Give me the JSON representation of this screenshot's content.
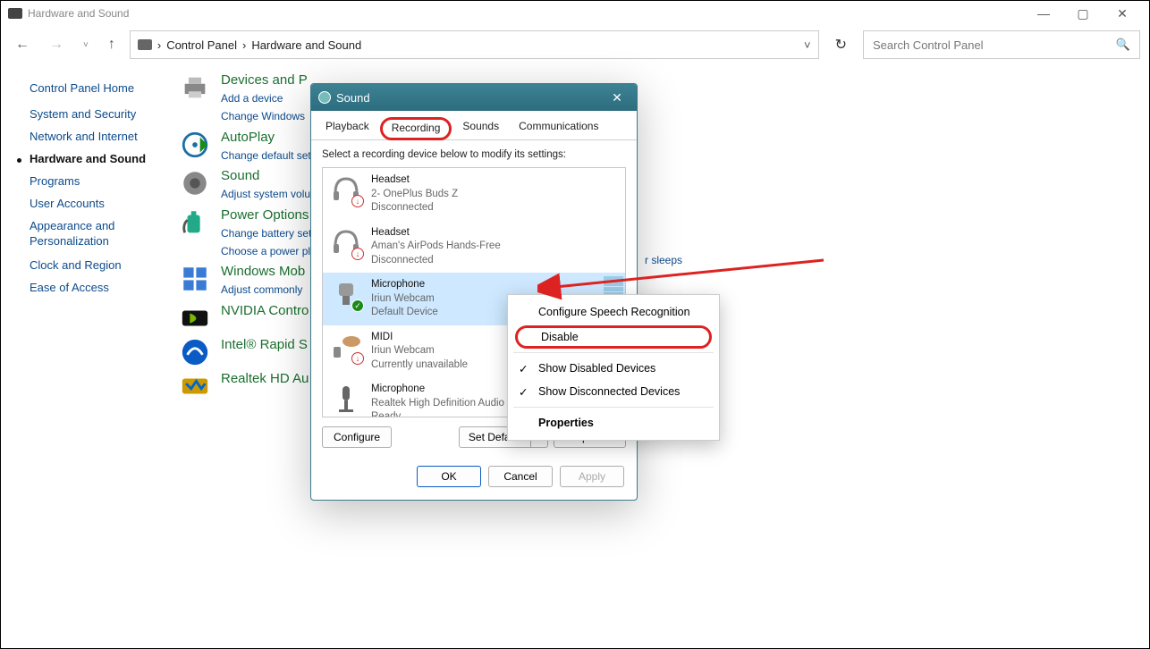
{
  "window": {
    "title": "Hardware and Sound"
  },
  "address": {
    "root": "Control Panel",
    "section": "Hardware and Sound"
  },
  "search": {
    "placeholder": "Search Control Panel"
  },
  "leftnav": {
    "home": "Control Panel Home",
    "items": [
      "System and Security",
      "Network and Internet",
      "Hardware and Sound",
      "Programs",
      "User Accounts",
      "Appearance and Personalization",
      "Clock and Region",
      "Ease of Access"
    ],
    "active_index": 2
  },
  "categories": [
    {
      "title": "Devices and P",
      "links": [
        "Add a device",
        "Change Windows"
      ]
    },
    {
      "title": "AutoPlay",
      "links": [
        "Change default set"
      ]
    },
    {
      "title": "Sound",
      "links": [
        "Adjust system volu"
      ]
    },
    {
      "title": "Power Options",
      "links": [
        "Change battery set",
        "Choose a power pl"
      ]
    },
    {
      "title": "Windows Mob",
      "links": [
        "Adjust commonly"
      ]
    },
    {
      "title": "NVIDIA Contro",
      "links": []
    },
    {
      "title": "Intel® Rapid S",
      "links": []
    },
    {
      "title": "Realtek HD Au",
      "links": []
    }
  ],
  "extra_link": "r sleeps",
  "dialog": {
    "title": "Sound",
    "tabs": [
      "Playback",
      "Recording",
      "Sounds",
      "Communications"
    ],
    "active_tab": 1,
    "instruction": "Select a recording device below to modify its settings:",
    "devices": [
      {
        "name": "Headset",
        "sub1": "2- OnePlus Buds Z",
        "sub2": "Disconnected",
        "badge": "red"
      },
      {
        "name": "Headset",
        "sub1": "Aman's AirPods Hands-Free",
        "sub2": "Disconnected",
        "badge": "red"
      },
      {
        "name": "Microphone",
        "sub1": "Iriun Webcam",
        "sub2": "Default Device",
        "badge": "green",
        "selected": true
      },
      {
        "name": "MIDI",
        "sub1": "Iriun Webcam",
        "sub2": "Currently unavailable",
        "badge": "red"
      },
      {
        "name": "Microphone",
        "sub1": "Realtek High Definition Audio",
        "sub2": "Ready",
        "badge": ""
      }
    ],
    "buttons": {
      "configure": "Configure",
      "setdefault": "Set Default",
      "properties": "Properties",
      "ok": "OK",
      "cancel": "Cancel",
      "apply": "Apply"
    }
  },
  "contextmenu": {
    "items": [
      {
        "label": "Configure Speech Recognition"
      },
      {
        "label": "Disable",
        "highlight": true
      },
      {
        "label": "Show Disabled Devices",
        "checked": true
      },
      {
        "label": "Show Disconnected Devices",
        "checked": true
      },
      {
        "label": "Properties",
        "bold": true
      }
    ]
  }
}
